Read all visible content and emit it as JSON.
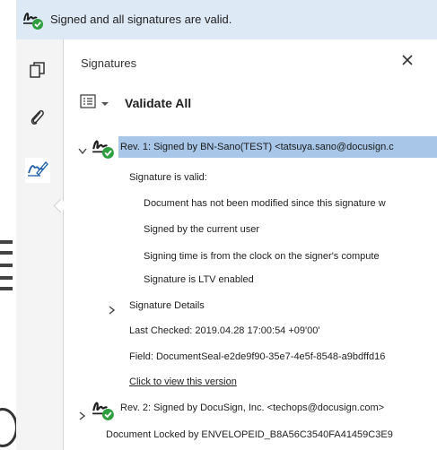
{
  "banner": {
    "text": "Signed and all signatures are valid."
  },
  "panel": {
    "title": "Signatures",
    "validate_all": "Validate All"
  },
  "tree": {
    "rev1": {
      "label": "Rev. 1: Signed by BN-Sano(TEST) <tatsuya.sano@docusign.c",
      "valid": "Signature is valid:",
      "details": [
        "Document has not been modified since this signature w",
        "Signed by the current user",
        "Signing time is from the clock on the signer's compute",
        "Signature is LTV enabled"
      ],
      "signature_details": "Signature Details",
      "last_checked": "Last Checked: 2019.04.28 17:00:54 +09'00'",
      "field": "Field: DocumentSeal-e2de9f90-35e7-4e5f-8548-a9bdffd16",
      "view_link": "Click to view this version"
    },
    "rev2": {
      "label": "Rev. 2: Signed by DocuSign, Inc. <techops@docusign.com>",
      "locked": "Document Locked by ENVELOPEID_B8A56C3540FA41459C3E9"
    }
  },
  "colors": {
    "banner_bg": "#dde9f5",
    "selected_row": "#a8c7e8",
    "valid_green": "#2e9e3f"
  },
  "icons": [
    "signature-valid-icon",
    "pages-icon",
    "paperclip-icon",
    "signature-pen-icon",
    "close-icon",
    "options-icon",
    "chevron-down-icon",
    "chevron-right-icon"
  ]
}
